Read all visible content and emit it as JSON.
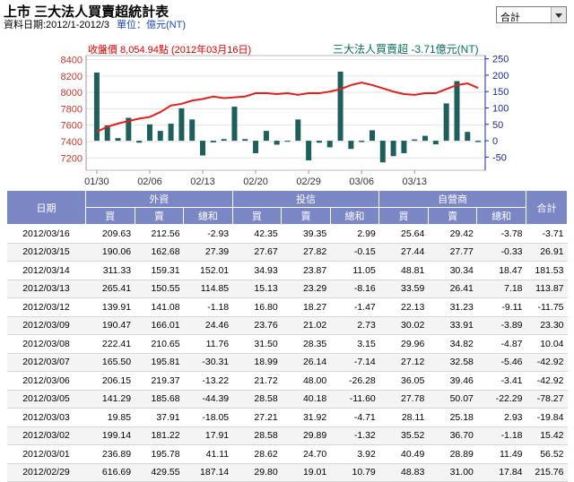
{
  "header": {
    "title": "上市 三大法人買賣超統計表",
    "date_range": "資料日期:2012/1-2012/3",
    "unit": "單位：億元(NT)"
  },
  "market_select": {
    "value": "合計"
  },
  "chart_data": {
    "type": "bar+line",
    "close_label": "收盤價 8,054.94點 (2012年03月16日)",
    "net_label": "三大法人買賣超 -3.71億元(NT)",
    "left_ticks": [
      "8400",
      "8200",
      "8000",
      "7800",
      "7600",
      "7400",
      "7200"
    ],
    "right_ticks": [
      "250",
      "200",
      "150",
      "100",
      "50",
      "0",
      "-50"
    ],
    "x_ticks": [
      "01/30",
      "02/06",
      "02/13",
      "02/20",
      "02/29",
      "03/06",
      "03/13"
    ],
    "ylim_left": [
      7050,
      8450
    ],
    "ylim_right": [
      -90,
      260
    ],
    "bars": [
      208,
      47,
      8,
      70,
      -6,
      50,
      30,
      52,
      99,
      65,
      -45,
      -5,
      5,
      104,
      5,
      -38,
      30,
      -12,
      -3,
      65,
      -60,
      -6,
      -20,
      211,
      -25,
      -4,
      32,
      -66,
      -47,
      -38,
      4,
      15,
      -11,
      114,
      182,
      27,
      -4
    ],
    "close": [
      7520,
      7580,
      7620,
      7650,
      7680,
      7700,
      7760,
      7840,
      7860,
      7900,
      7920,
      7950,
      7930,
      7940,
      7950,
      7990,
      7990,
      7980,
      7990,
      7970,
      7990,
      7990,
      8010,
      8040,
      8090,
      8120,
      8090,
      8050,
      8010,
      7980,
      7970,
      7990,
      7990,
      8040,
      8090,
      8110,
      8054
    ]
  },
  "table": {
    "headers": {
      "date": "日期",
      "foreign": "外資",
      "trust": "投信",
      "dealer": "自營商",
      "total": "合計",
      "buy": "買",
      "sell": "賣",
      "net": "總和"
    },
    "rows": [
      [
        "2012/03/16",
        "209.63",
        "212.56",
        "-2.93",
        "42.35",
        "39.35",
        "2.99",
        "25.64",
        "29.42",
        "-3.78",
        "-3.71"
      ],
      [
        "2012/03/15",
        "190.06",
        "162.68",
        "27.39",
        "27.67",
        "27.82",
        "-0.15",
        "27.44",
        "27.77",
        "-0.33",
        "26.91"
      ],
      [
        "2012/03/14",
        "311.33",
        "159.31",
        "152.01",
        "34.93",
        "23.87",
        "11.05",
        "48.81",
        "30.34",
        "18.47",
        "181.53"
      ],
      [
        "2012/03/13",
        "265.41",
        "150.55",
        "114.85",
        "15.13",
        "23.29",
        "-8.16",
        "33.59",
        "26.41",
        "7.18",
        "113.87"
      ],
      [
        "2012/03/12",
        "139.91",
        "141.08",
        "-1.18",
        "16.80",
        "18.27",
        "-1.47",
        "22.13",
        "31.23",
        "-9.11",
        "-11.75"
      ],
      [
        "2012/03/09",
        "190.47",
        "166.01",
        "24.46",
        "23.76",
        "21.02",
        "2.73",
        "30.02",
        "33.91",
        "-3.89",
        "23.30"
      ],
      [
        "2012/03/08",
        "222.41",
        "210.65",
        "11.76",
        "31.50",
        "28.35",
        "3.15",
        "29.96",
        "34.82",
        "-4.87",
        "10.04"
      ],
      [
        "2012/03/07",
        "165.50",
        "195.81",
        "-30.31",
        "18.99",
        "26.14",
        "-7.14",
        "27.12",
        "32.58",
        "-5.46",
        "-42.92"
      ],
      [
        "2012/03/06",
        "206.15",
        "219.37",
        "-13.22",
        "21.72",
        "48.00",
        "-26.28",
        "36.05",
        "39.46",
        "-3.41",
        "-42.92"
      ],
      [
        "2012/03/05",
        "141.29",
        "185.68",
        "-44.39",
        "28.58",
        "40.18",
        "-11.60",
        "27.78",
        "50.07",
        "-22.29",
        "-78.27"
      ],
      [
        "2012/03/03",
        "19.85",
        "37.91",
        "-18.05",
        "27.21",
        "31.92",
        "-4.71",
        "28.11",
        "25.18",
        "2.93",
        "-19.84"
      ],
      [
        "2012/03/02",
        "199.14",
        "181.22",
        "17.91",
        "28.58",
        "29.89",
        "-1.32",
        "35.52",
        "36.70",
        "-1.18",
        "15.42"
      ],
      [
        "2012/03/01",
        "236.89",
        "195.78",
        "41.11",
        "28.62",
        "24.70",
        "3.92",
        "40.49",
        "28.89",
        "11.49",
        "56.52"
      ],
      [
        "2012/02/29",
        "616.69",
        "429.55",
        "187.14",
        "29.80",
        "19.01",
        "10.79",
        "48.83",
        "31.00",
        "17.84",
        "215.76"
      ]
    ]
  },
  "colors": {
    "bar": "#1e5f5a",
    "close_line": "#e21f1f",
    "header_bg": "#7b86c4",
    "left_axis": "#c0392b",
    "right_axis": "#1a2a8c"
  }
}
